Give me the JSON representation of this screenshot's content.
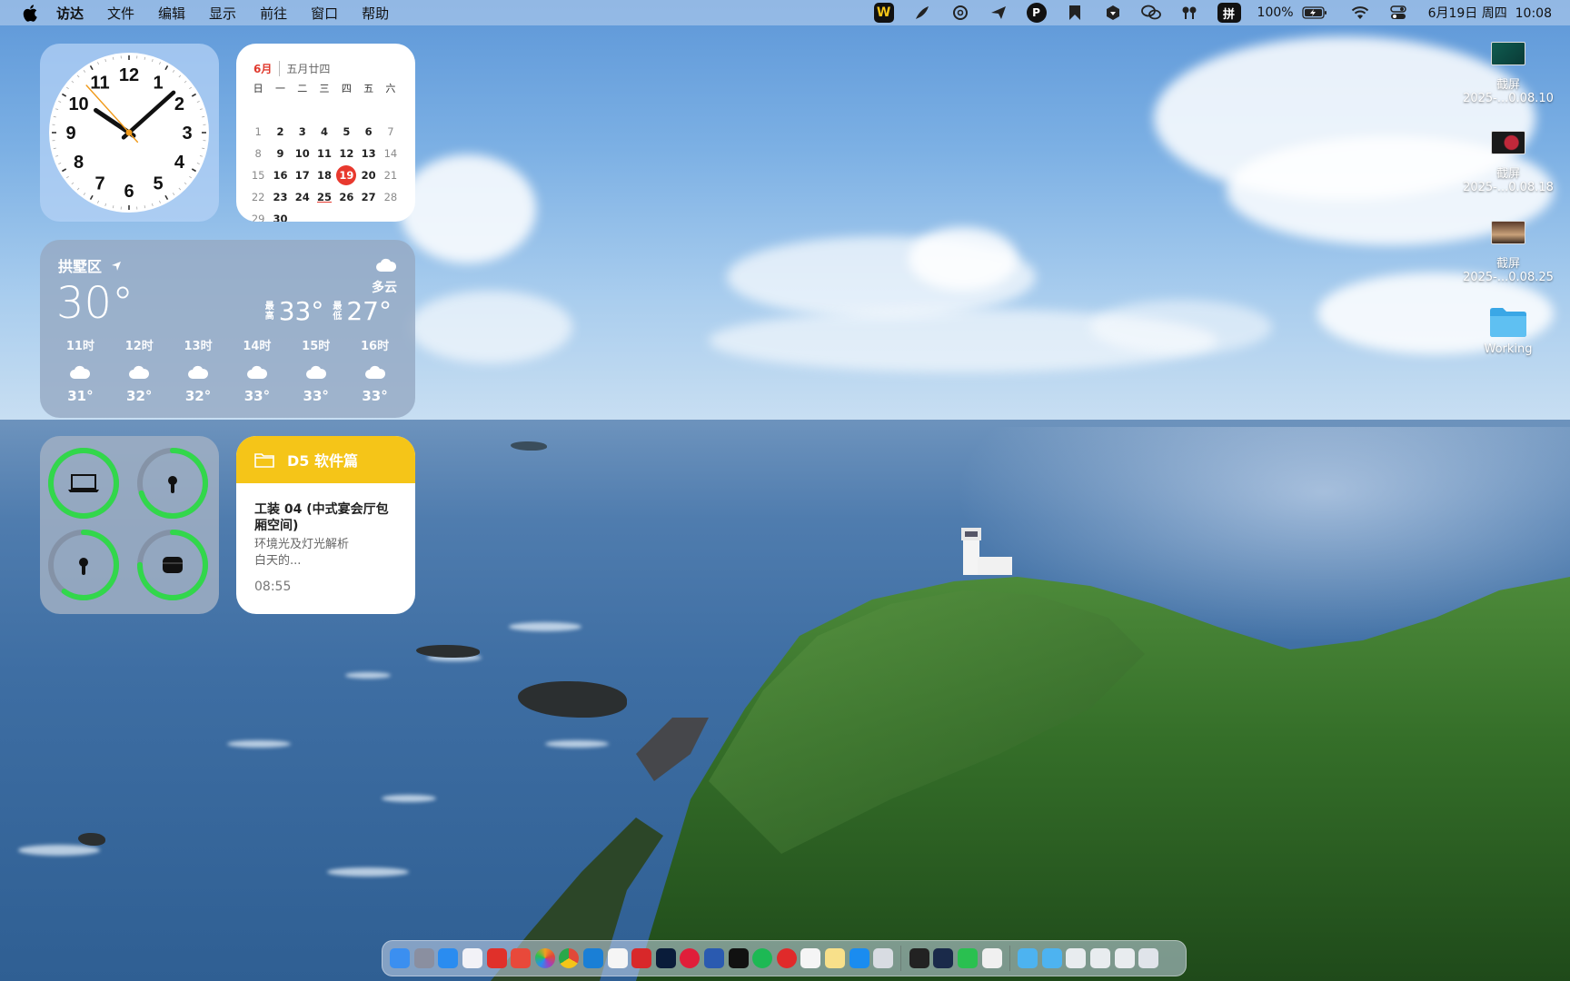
{
  "menubar": {
    "items": [
      "访达",
      "文件",
      "编辑",
      "显示",
      "前往",
      "窗口",
      "帮助"
    ],
    "status_icons": [
      "wps-icon",
      "feather-icon",
      "chatgpt-icon",
      "send-icon",
      "p-icon",
      "bookmark-icon",
      "cube-icon",
      "wechat-icon",
      "airpods-icon"
    ],
    "input_method": "拼",
    "battery_percent": "100%",
    "datetime": "6月19日 周四  10:08"
  },
  "calendar": {
    "month": "6月",
    "lunar": "五月廿四",
    "weekdays": [
      "日",
      "一",
      "二",
      "三",
      "四",
      "五",
      "六"
    ],
    "days": [
      "",
      "",
      "",
      "",
      "",
      "",
      "",
      "1",
      "2",
      "3",
      "4",
      "5",
      "6",
      "7",
      "8",
      "9",
      "10",
      "11",
      "12",
      "13",
      "14",
      "15",
      "16",
      "17",
      "18",
      "19",
      "20",
      "21",
      "22",
      "23",
      "24",
      "25",
      "26",
      "27",
      "28",
      "29",
      "30"
    ],
    "today": "19"
  },
  "weather": {
    "location": "拱墅区",
    "temperature": "30°",
    "condition": "多云",
    "high_label": "最高",
    "high": "33°",
    "low_label": "最低",
    "low": "27°",
    "hours": [
      {
        "time": "11时",
        "temp": "31°"
      },
      {
        "time": "12时",
        "temp": "32°"
      },
      {
        "time": "13时",
        "temp": "32°"
      },
      {
        "time": "14时",
        "temp": "33°"
      },
      {
        "time": "15时",
        "temp": "33°"
      },
      {
        "time": "16时",
        "temp": "33°"
      }
    ]
  },
  "batteries": [
    {
      "device": "laptop-icon",
      "level": 1.0
    },
    {
      "device": "airpod-left-icon",
      "level": 0.7
    },
    {
      "device": "airpod-right-icon",
      "level": 0.6
    },
    {
      "device": "airpods-case-icon",
      "level": 0.75
    }
  ],
  "notes": {
    "folder": "D5 软件篇",
    "title": "工装 04 (中式宴会厅包厢空间)",
    "body": "环境光及灯光解析\n白天的...",
    "time": "08:55"
  },
  "desktop": {
    "icons": [
      {
        "line1": "截屏",
        "line2": "2025-...0.08.10"
      },
      {
        "line1": "截屏",
        "line2": "2025-...0.08.18"
      },
      {
        "line1": "截屏",
        "line2": "2025-...0.08.25"
      },
      {
        "line1": "Working",
        "line2": ""
      }
    ]
  },
  "colors": {
    "accent_red": "#e8392e",
    "notes_yellow": "#f5c518",
    "battery_green": "#32d74b"
  },
  "dock": {
    "apps": [
      "finder",
      "launchpad",
      "safari",
      "freeform",
      "wps",
      "xmind",
      "photos",
      "chrome",
      "edge",
      "arc",
      "acrobat",
      "photoshop",
      "pinterest",
      "word",
      "tiktok",
      "spotify",
      "netease-music",
      "chatgpt",
      "notes",
      "app-store",
      "preview",
      "terminal",
      "cube",
      "wechat",
      "icloud",
      "folder-1",
      "folder-2",
      "stack-1",
      "stack-2",
      "stack-3",
      "trash"
    ]
  }
}
